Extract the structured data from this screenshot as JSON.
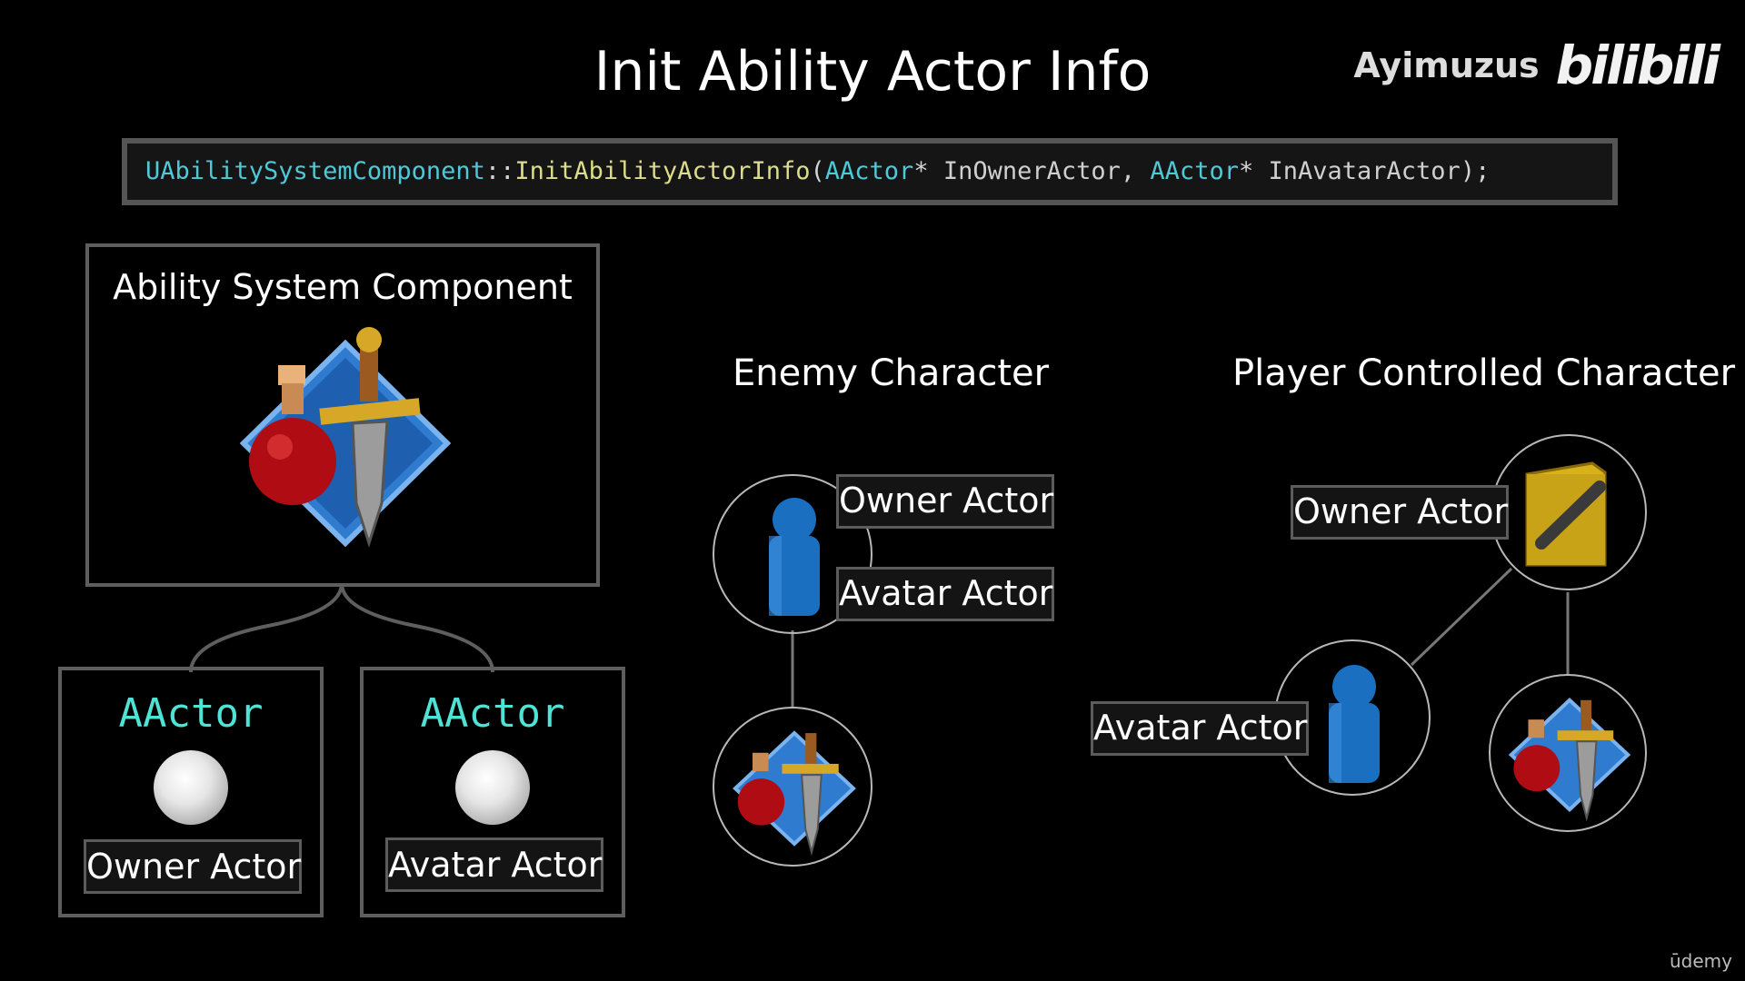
{
  "slide": {
    "title": "Init Ability Actor Info",
    "watermark_author": "Ayimuzus",
    "watermark_logo": "bilibili",
    "corner_brand": "ūdemy"
  },
  "code": {
    "class": "UAbilitySystemComponent",
    "scope": "::",
    "function": "InitAbilityActorInfo",
    "open": "(",
    "type1": "AActor",
    "ptr1": "* ",
    "param1": "InOwnerActor",
    "comma": ", ",
    "type2": "AActor",
    "ptr2": "* ",
    "param2": "InAvatarActor",
    "close": ");"
  },
  "asc_panel": {
    "title": "Ability System Component",
    "left_box": {
      "type": "AActor",
      "label": "Owner Actor"
    },
    "right_box": {
      "type": "AActor",
      "label": "Avatar Actor"
    }
  },
  "enemy": {
    "heading": "Enemy Character",
    "owner_label": "Owner Actor",
    "avatar_label": "Avatar Actor"
  },
  "player": {
    "heading": "Player Controlled Character",
    "owner_label": "Owner Actor",
    "avatar_label": "Avatar Actor"
  },
  "icons": [
    "ability-system-icon",
    "pawn-icon",
    "player-state-icon",
    "actor-sphere-icon"
  ],
  "colors": {
    "type_cyan": "#4ec9d8",
    "function_yellow": "#dcdc8a",
    "aactor_cyan": "#4ee3d4",
    "pawn_blue": "#1a6fc0",
    "player_state_gold": "#d8b21a"
  }
}
